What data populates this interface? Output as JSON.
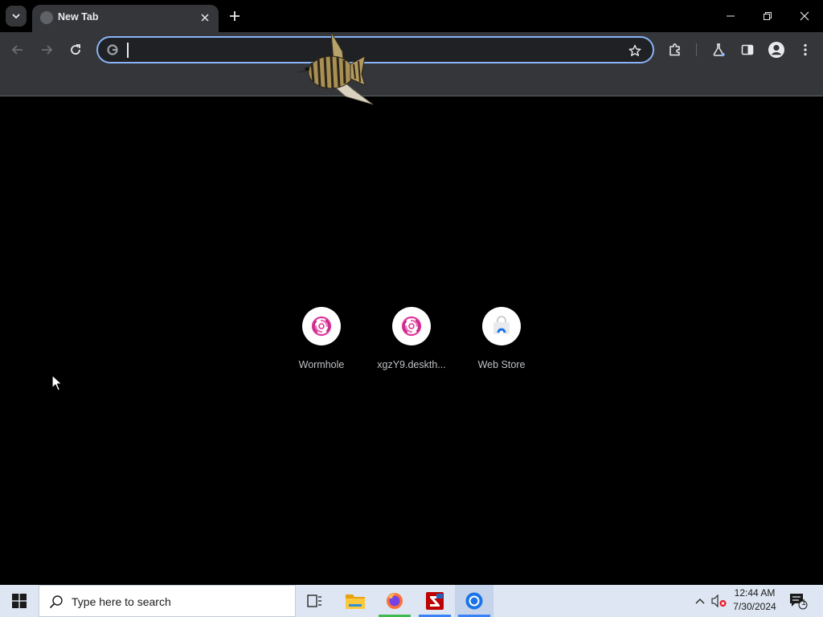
{
  "window": {
    "tab_title": "New Tab",
    "controls": [
      "minimize",
      "restore",
      "close"
    ]
  },
  "toolbar": {
    "omnibox_value": "",
    "icons": [
      "back-icon",
      "forward-icon",
      "reload-icon",
      "bookmark-star-icon",
      "extensions-icon",
      "labs-icon",
      "side-panel-icon",
      "profile-icon",
      "menu-icon"
    ]
  },
  "shortcuts": [
    {
      "label": "Wormhole",
      "icon": "wormhole-icon"
    },
    {
      "label": "xgzY9.deskth...",
      "icon": "wormhole-icon"
    },
    {
      "label": "Web Store",
      "icon": "web-store-icon"
    }
  ],
  "taskbar": {
    "search_placeholder": "Type here to search",
    "apps": [
      "task-view-icon",
      "file-explorer-icon",
      "firefox-icon",
      "filezilla-icon",
      "chrome-icon"
    ],
    "clock": {
      "time": "12:44 AM",
      "date": "7/30/2024"
    },
    "notification_count": "1"
  },
  "colors": {
    "accent": "#8ab4f8",
    "toolbar_bg": "#35363a",
    "ntp_bg": "#000000",
    "taskbar_bg": "#dde6f2"
  }
}
